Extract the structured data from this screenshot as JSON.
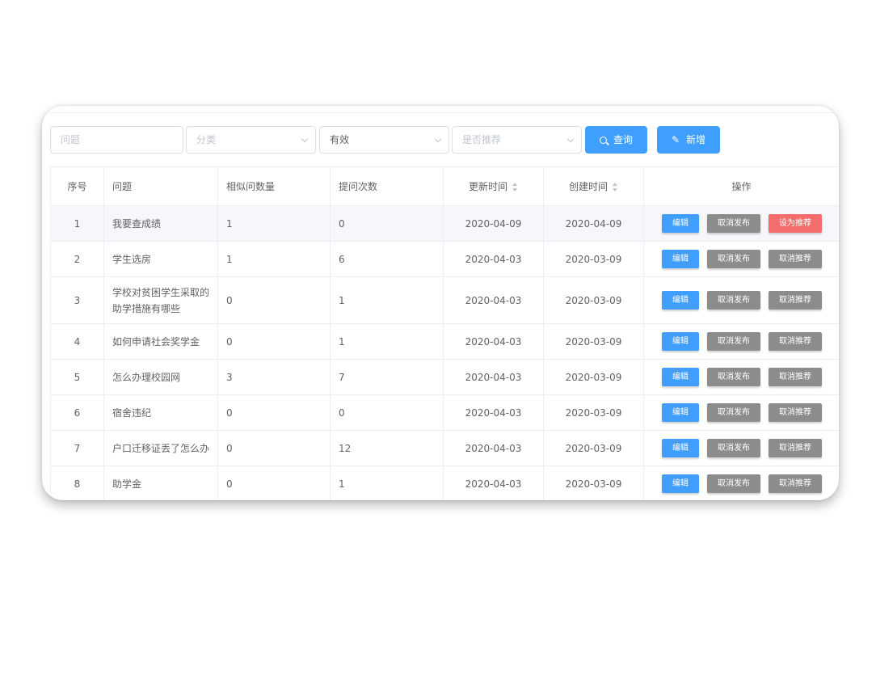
{
  "filters": {
    "question_placeholder": "问题",
    "category_placeholder": "分类",
    "status_value": "有效",
    "recommend_placeholder": "是否推荐",
    "search_label": "查询",
    "add_label": "新增",
    "search_icon": "search-icon",
    "add_icon": "edit-pen-icon"
  },
  "table": {
    "headers": {
      "index": "序号",
      "question": "问题",
      "similar_count": "相似问数量",
      "ask_count": "提问次数",
      "updated": "更新时间",
      "created": "创建时间",
      "actions": "操作"
    },
    "rows": [
      {
        "index": "1",
        "question": "我要查成绩",
        "similar": "1",
        "asks": "0",
        "updated": "2020-04-09",
        "created": "2020-04-09",
        "edit": "编辑",
        "publish": "取消发布",
        "recommend": "设为推荐",
        "recommend_state": "danger"
      },
      {
        "index": "2",
        "question": "学生选房",
        "similar": "1",
        "asks": "6",
        "updated": "2020-04-03",
        "created": "2020-03-09",
        "edit": "编辑",
        "publish": "取消发布",
        "recommend": "取消推荐",
        "recommend_state": "default"
      },
      {
        "index": "3",
        "question": "学校对贫困学生采取的助学措施有哪些",
        "similar": "0",
        "asks": "1",
        "updated": "2020-04-03",
        "created": "2020-03-09",
        "edit": "编辑",
        "publish": "取消发布",
        "recommend": "取消推荐",
        "recommend_state": "default"
      },
      {
        "index": "4",
        "question": "如何申请社会奖学金",
        "similar": "0",
        "asks": "1",
        "updated": "2020-04-03",
        "created": "2020-03-09",
        "edit": "编辑",
        "publish": "取消发布",
        "recommend": "取消推荐",
        "recommend_state": "default"
      },
      {
        "index": "5",
        "question": "怎么办理校园网",
        "similar": "3",
        "asks": "7",
        "updated": "2020-04-03",
        "created": "2020-03-09",
        "edit": "编辑",
        "publish": "取消发布",
        "recommend": "取消推荐",
        "recommend_state": "default"
      },
      {
        "index": "6",
        "question": "宿舍违纪",
        "similar": "0",
        "asks": "0",
        "updated": "2020-04-03",
        "created": "2020-03-09",
        "edit": "编辑",
        "publish": "取消发布",
        "recommend": "取消推荐",
        "recommend_state": "default"
      },
      {
        "index": "7",
        "question": "户口迁移证丢了怎么办",
        "similar": "0",
        "asks": "12",
        "updated": "2020-04-03",
        "created": "2020-03-09",
        "edit": "编辑",
        "publish": "取消发布",
        "recommend": "取消推荐",
        "recommend_state": "default"
      },
      {
        "index": "8",
        "question": "助学金",
        "similar": "0",
        "asks": "1",
        "updated": "2020-04-03",
        "created": "2020-03-09",
        "edit": "编辑",
        "publish": "取消发布",
        "recommend": "取消推荐",
        "recommend_state": "default"
      }
    ]
  },
  "colors": {
    "primary": "#409eff",
    "danger": "#f56c6c",
    "muted_button": "#8c8c8c"
  }
}
